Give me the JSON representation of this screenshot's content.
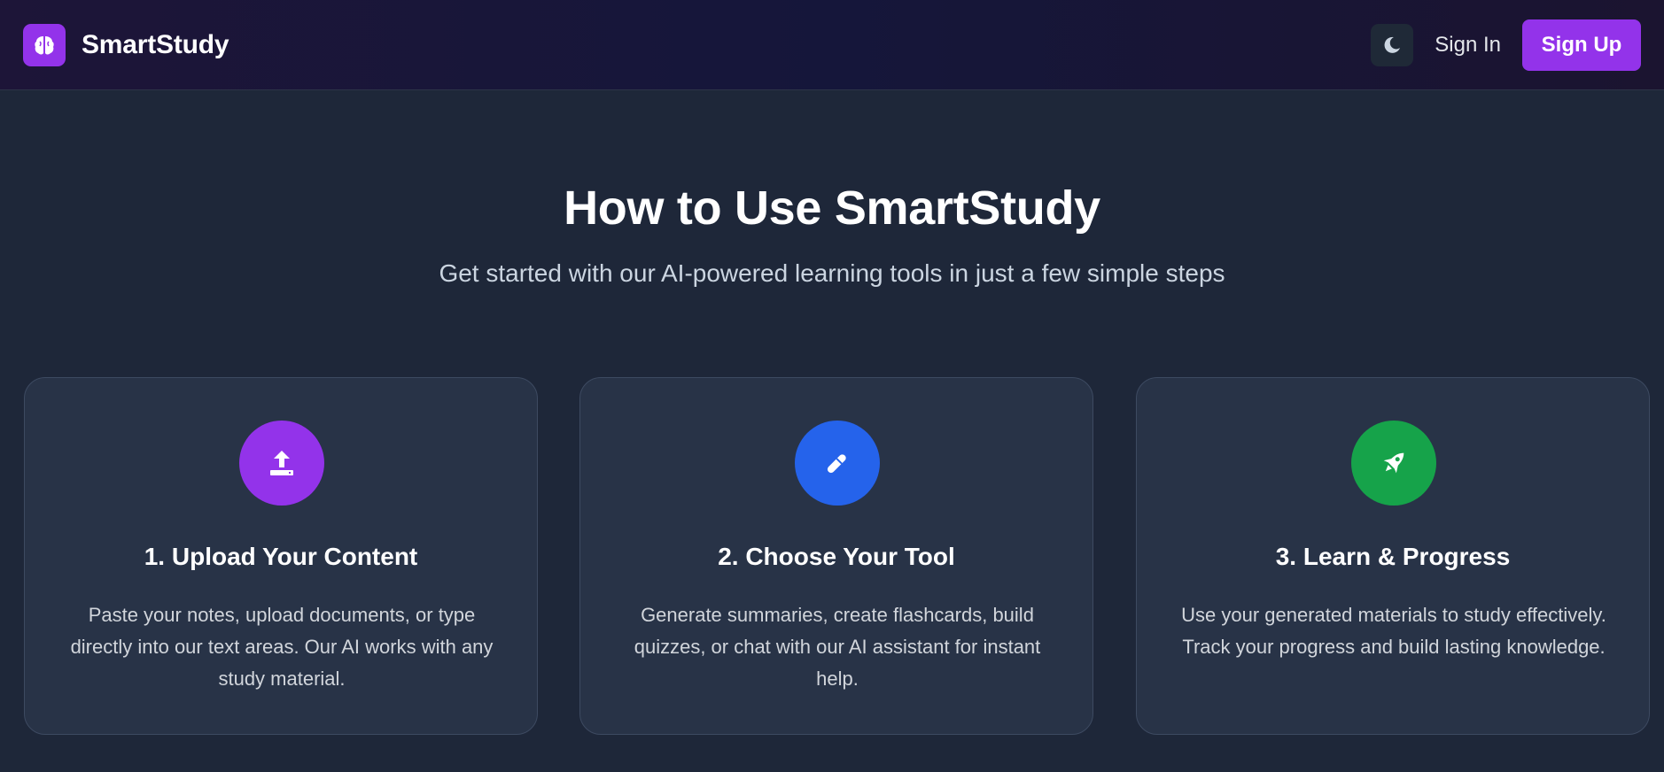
{
  "header": {
    "brand_name": "SmartStudy",
    "brand_icon": "brain-icon",
    "theme_icon": "moon-icon",
    "sign_in": "Sign In",
    "sign_up": "Sign Up"
  },
  "hero": {
    "title": "How to Use SmartStudy",
    "subtitle": "Get started with our AI-powered learning tools in just a few simple steps"
  },
  "steps": [
    {
      "title": "1. Upload Your Content",
      "description": "Paste your notes, upload documents, or type directly into our text areas. Our AI works with any study material.",
      "icon": "upload-icon",
      "color": "#9333ea"
    },
    {
      "title": "2. Choose Your Tool",
      "description": "Generate summaries, create flashcards, build quizzes, or chat with our AI assistant for instant help.",
      "icon": "pen-icon",
      "color": "#2563eb"
    },
    {
      "title": "3. Learn & Progress",
      "description": "Use your generated materials to study effectively. Track your progress and build lasting knowledge.",
      "icon": "rocket-icon",
      "color": "#16a34a"
    }
  ],
  "colors": {
    "accent": "#9333ea",
    "background": "#1e2739",
    "card": "#283347"
  }
}
